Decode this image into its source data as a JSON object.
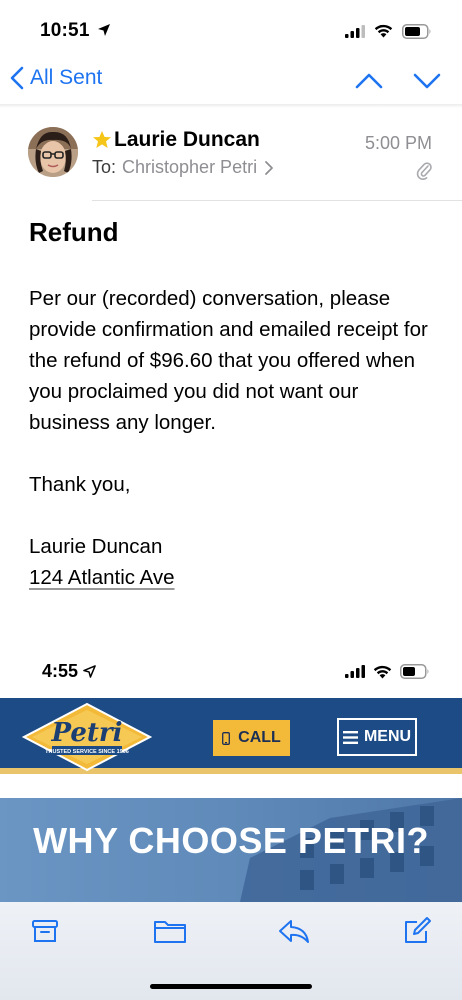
{
  "status_bar": {
    "time": "10:51"
  },
  "nav": {
    "back_label": "All Sent"
  },
  "email": {
    "sender": "Laurie Duncan",
    "to_label": "To:",
    "recipient": "Christopher Petri",
    "time": "5:00 PM",
    "subject": "Refund",
    "body": [
      "Per our (recorded) conversation, please provide confirmation and emailed receipt for the refund of $96.60 that you offered when you proclaimed you did not want our business any longer.",
      "Thank you,"
    ],
    "signature_name": "Laurie Duncan",
    "signature_address": "124 Atlantic Ave"
  },
  "embedded_screenshot": {
    "status_time": "4:55",
    "logo_text": "Petri",
    "logo_tagline": "TRUSTED SERVICE SINCE 1906",
    "call_label": "CALL",
    "menu_label": "MENU",
    "hero_title": "WHY CHOOSE PETRI?"
  },
  "icons": {
    "toolbar": [
      "archive-icon",
      "folder-icon",
      "reply-icon",
      "compose-icon"
    ]
  },
  "colors": {
    "ios_blue": "#1e74f0",
    "petri_navy": "#1c4b85",
    "petri_yellow": "#f3b939",
    "star": "#f5c518"
  }
}
